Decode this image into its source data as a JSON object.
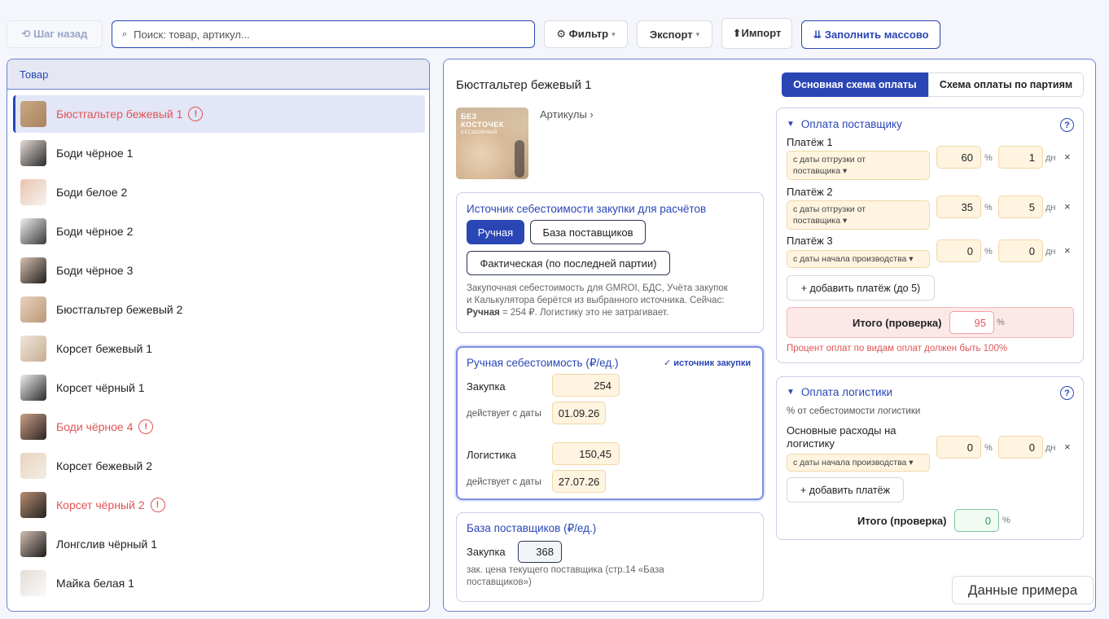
{
  "toolbar": {
    "back_label": "⟲ Шаг назад",
    "search_placeholder": "Поиск: товар, артикул...",
    "filter_label": "⚙ Фильтр",
    "export_label": "Экспорт",
    "import_label": "⬆Импорт",
    "bulk_fill_label": "⇊ Заполнить массово"
  },
  "list": {
    "header": "Товар",
    "items": [
      {
        "name": "Бюстгальтер бежевый 1",
        "error": true,
        "selected": true
      },
      {
        "name": "Боди чёрное 1",
        "error": false
      },
      {
        "name": "Боди белое 2",
        "error": false
      },
      {
        "name": "Боди чёрное 2",
        "error": false
      },
      {
        "name": "Боди чёрное 3",
        "error": false
      },
      {
        "name": "Бюстгальтер бежевый 2",
        "error": false
      },
      {
        "name": "Корсет бежевый 1",
        "error": false
      },
      {
        "name": "Корсет чёрный 1",
        "error": false
      },
      {
        "name": "Боди чёрное 4",
        "error": true
      },
      {
        "name": "Корсет бежевый 2",
        "error": false
      },
      {
        "name": "Корсет чёрный 2",
        "error": true
      },
      {
        "name": "Лонгслив чёрный 1",
        "error": false
      },
      {
        "name": "Майка белая 1",
        "error": false
      }
    ]
  },
  "product": {
    "title": "Бюстгальтер бежевый 1",
    "articles_label": "Артикулы ›",
    "image_text_line1": "БЕЗ",
    "image_text_line2": "КОСТОЧЕК",
    "image_text_line3": "БЕСШОВНЫЙ"
  },
  "scheme_tabs": {
    "main": "Основная схема оплаты",
    "by_batch": "Схема оплаты по партиям"
  },
  "cost_source": {
    "title": "Источник себестоимости закупки для расчётов",
    "opt_manual": "Ручная",
    "opt_suppliers": "База поставщиков",
    "opt_actual": "Фактическая (по последней партии)",
    "note_1": "Закупочная себестоимость для GMROI, БДС, Учёта закупок",
    "note_2": "и Калькулятора берётся из выбранного источника. Сейчас:",
    "note_bold": "Ручная",
    "note_3": " = 254 ₽. Логистику это не затрагивает."
  },
  "manual_cost": {
    "title": "Ручная себестоимость (₽/ед.)",
    "badge": "✓ источник закупки",
    "purchase_label": "Закупка",
    "purchase_value": "254",
    "valid_from_label": "действует с даты",
    "purchase_date": "01.09.26",
    "logistics_label": "Логистика",
    "logistics_value": "150,45",
    "logistics_date": "27.07.26"
  },
  "supplier_base": {
    "title": "База поставщиков (₽/ед.)",
    "purchase_label": "Закупка",
    "purchase_value": "368",
    "note_1": "зак. цена текущего поставщика (стр.14 «База",
    "note_2": "поставщиков»)"
  },
  "supplier_payment": {
    "title": "Оплата поставщику",
    "help": "?",
    "payments": [
      {
        "label": "Платёж 1",
        "basis_1": "с даты отгрузки от",
        "basis_2": "поставщика ▾",
        "pct": "60",
        "days": "1"
      },
      {
        "label": "Платёж 2",
        "basis_1": "с даты отгрузки от",
        "basis_2": "поставщика ▾",
        "pct": "35",
        "days": "5"
      },
      {
        "label": "Платёж 3",
        "basis_1": "с даты начала производства ▾",
        "basis_2": "",
        "pct": "0",
        "days": "0"
      }
    ],
    "pct_unit": "%",
    "days_unit": "дн",
    "remove": "×",
    "add_label": "+ добавить платёж (до 5)",
    "total_label": "Итого (проверка)",
    "total_value": "95",
    "error_text": "Процент оплат по видам оплат должен быть 100%"
  },
  "logistics_payment": {
    "title": "Оплата логистики",
    "help": "?",
    "subtitle": "% от себестоимости логистики",
    "main_label_1": "Основные расходы на",
    "main_label_2": "логистику",
    "basis": "с даты начала производства ▾",
    "pct": "0",
    "days": "0",
    "add_label": "+ добавить платёж",
    "total_label": "Итого (проверка)",
    "total_value": "0"
  },
  "sample_button": "Данные примера",
  "colors": {
    "accent": "#2a46b5",
    "error": "#e05555",
    "field_bg": "#fef4e0"
  }
}
